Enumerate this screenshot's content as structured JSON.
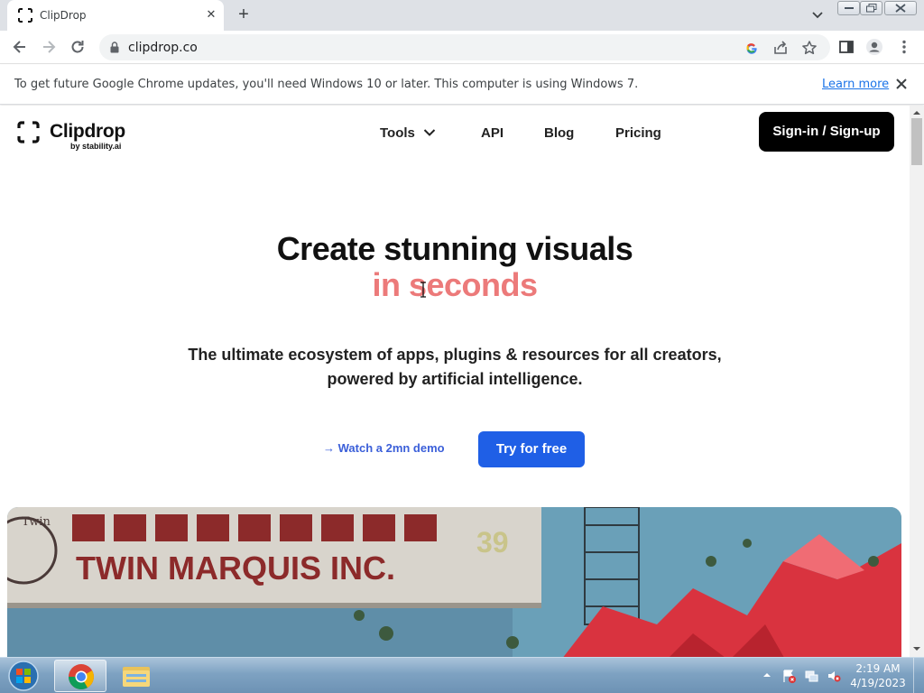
{
  "browser": {
    "tab_title": "ClipDrop",
    "url": "clipdrop.co",
    "icons": [
      "back-icon",
      "forward-icon",
      "reload-icon",
      "lock-icon",
      "google-lens-icon",
      "share-icon",
      "star-icon",
      "side-panel-icon",
      "profile-icon",
      "menu-icon"
    ]
  },
  "infobar": {
    "message": "To get future Google Chrome updates, you'll need Windows 10 or later. This computer is using Windows 7.",
    "link": "Learn more"
  },
  "site": {
    "logo_name": "Clipdrop",
    "logo_sub": "by stability.ai",
    "nav": {
      "tools": "Tools",
      "api": "API",
      "blog": "Blog",
      "pricing": "Pricing"
    },
    "signin": "Sign-in / Sign-up"
  },
  "hero": {
    "title_line1": "Create stunning visuals",
    "title_line2": "in seconds",
    "subtitle_line1": "The ultimate ecosystem of apps, plugins & resources for all creators,",
    "subtitle_line2": "powered by artificial intelligence.",
    "demo_link": "→ Watch a 2mn demo",
    "cta": "Try for free"
  },
  "banner": {
    "sign_text": "TWIN MARQUIS INC.",
    "sign_number": "39",
    "stamp_text": "Twin"
  },
  "taskbar": {
    "time": "2:19 AM",
    "date": "4/19/2023"
  },
  "colors": {
    "accent_pink": "#ec7a7a",
    "cta_blue": "#1f5fe6",
    "link_blue": "#3b5fd9"
  }
}
